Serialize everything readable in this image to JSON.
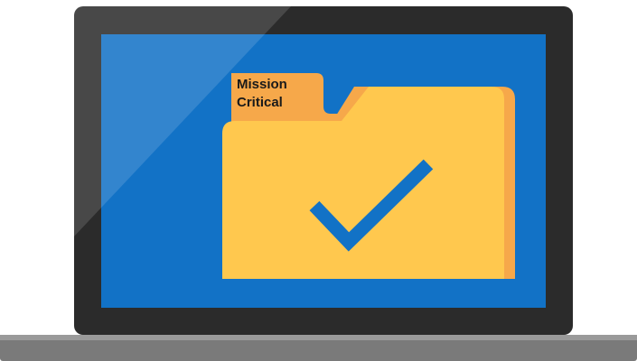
{
  "folder": {
    "label_line1": "Mission",
    "label_line2": "Critical",
    "status_icon": "checkmark-icon"
  },
  "colors": {
    "bezel": "#2b2b2b",
    "screen": "#1272c6",
    "screen_glare": "#4a9ee0",
    "base": "#7a7a7a",
    "base_top": "#9a9a9a",
    "folder_back": "#f6a84a",
    "folder_front": "#ffc84e",
    "folder_tab": "#f6a84a",
    "checkmark": "#1272c6"
  }
}
